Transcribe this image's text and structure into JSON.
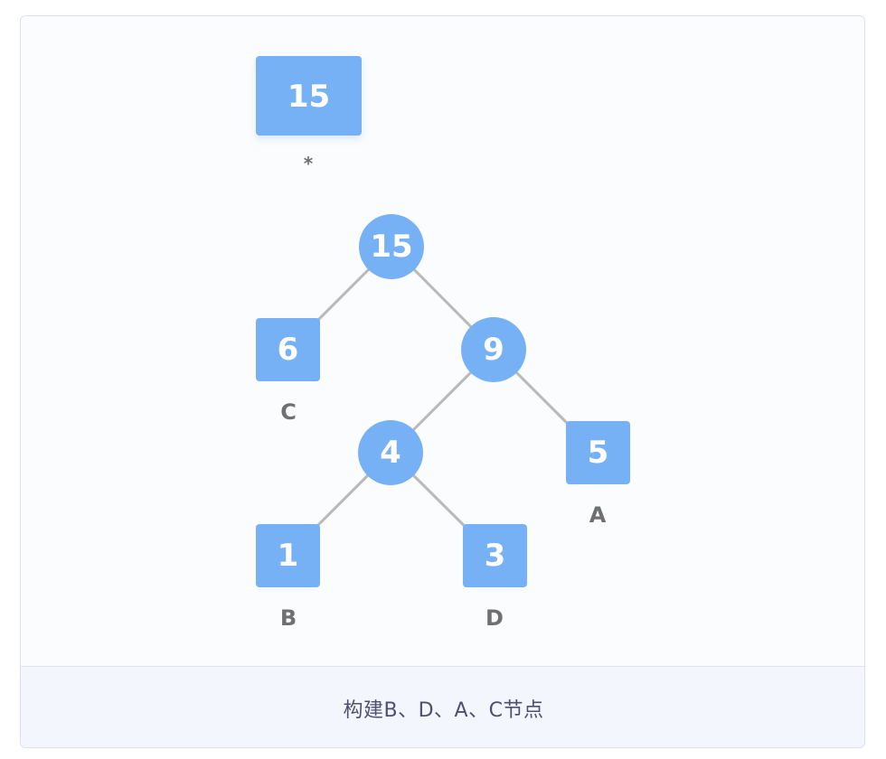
{
  "diagram": {
    "top_block": {
      "value": "15",
      "label": "*"
    },
    "tree": {
      "root": {
        "value": "15"
      },
      "internal": [
        {
          "id": "n9",
          "value": "9"
        },
        {
          "id": "n4",
          "value": "4"
        }
      ],
      "leaves": [
        {
          "id": "leaf-c",
          "value": "6",
          "label": "C"
        },
        {
          "id": "leaf-a",
          "value": "5",
          "label": "A"
        },
        {
          "id": "leaf-b",
          "value": "1",
          "label": "B"
        },
        {
          "id": "leaf-d",
          "value": "3",
          "label": "D"
        }
      ]
    }
  },
  "caption": "构建B、D、A、C节点",
  "colors": {
    "node": "#77b1f5",
    "edge": "#b9b9b9",
    "label": "#707070",
    "caption_bg": "#f3f6fd"
  }
}
